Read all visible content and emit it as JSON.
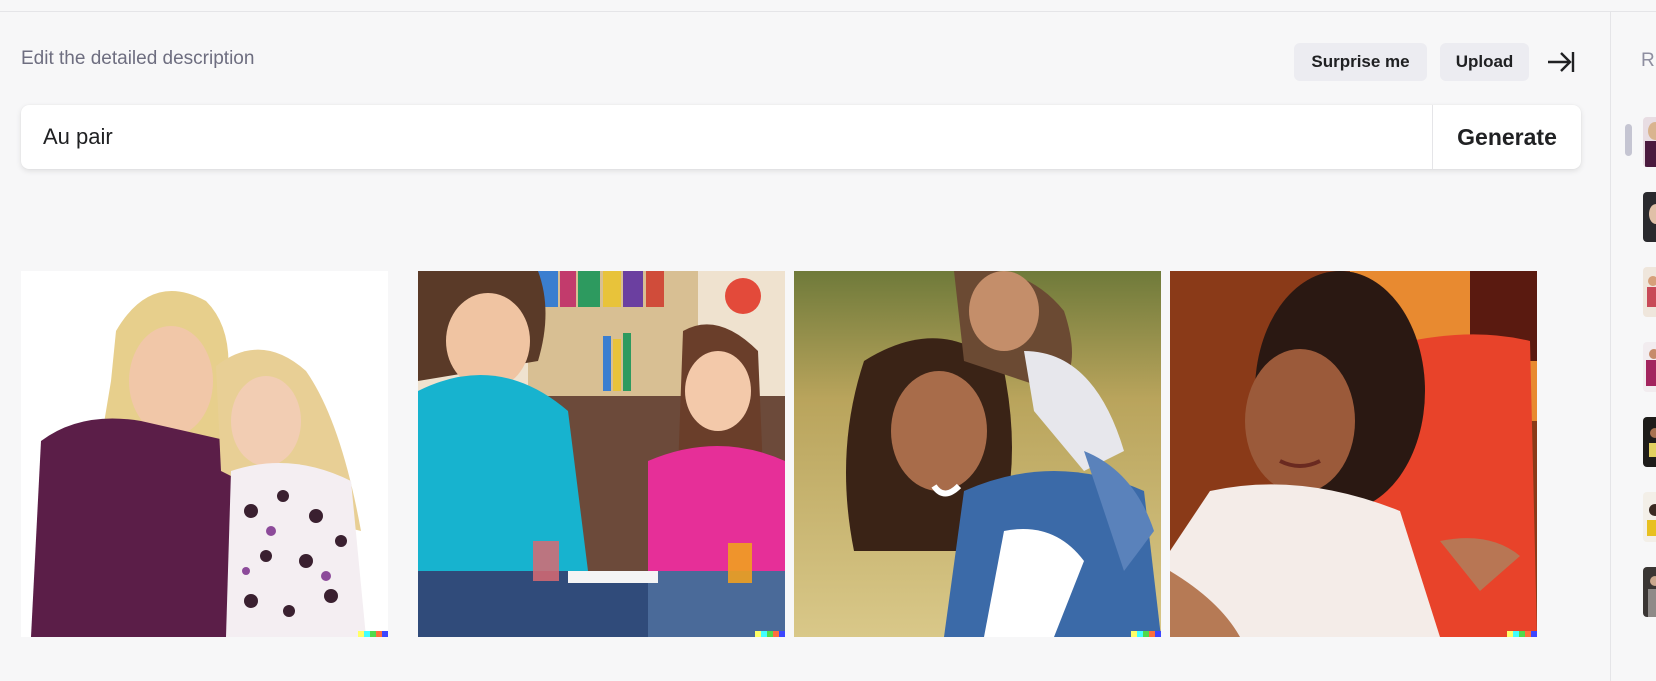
{
  "header": {
    "description_label": "Edit the detailed description",
    "surprise_label": "Surprise me",
    "upload_label": "Upload"
  },
  "prompt": {
    "value": "Au pair",
    "generate_label": "Generate"
  },
  "results": [
    {
      "name": "result-image-1",
      "subject": "blonde woman and girl embracing on white background"
    },
    {
      "name": "result-image-2",
      "subject": "woman and girl on sofa with juice glasses"
    },
    {
      "name": "result-image-3",
      "subject": "woman giving girl piggyback ride outdoors"
    },
    {
      "name": "result-image-4",
      "subject": "woman talking beside red pillow"
    }
  ],
  "sidebar": {
    "title_initial": "R",
    "thumbnail_count": 7
  },
  "colors": {
    "background": "#f7f7f8",
    "button_bg": "#ececf1",
    "text": "#202123",
    "muted": "#6e6e80"
  }
}
